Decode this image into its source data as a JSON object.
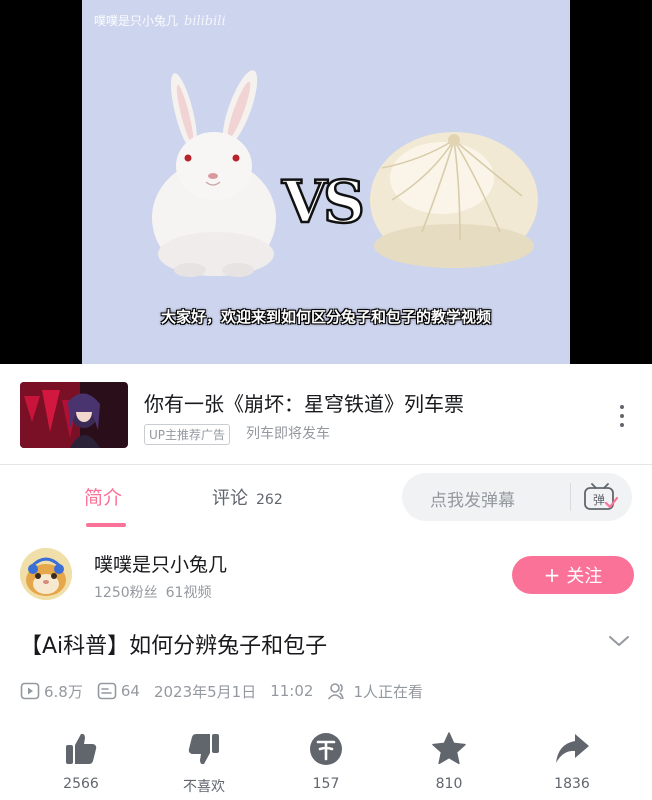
{
  "video": {
    "watermark_text": "噗噗是只小兔几",
    "watermark_logo": "bilibili",
    "subtitle": "大家好，欢迎来到如何区分兔子和包子的教学视频",
    "vs_text": "VS"
  },
  "ad": {
    "title": "你有一张《崩坏：星穹铁道》列车票",
    "badge": "UP主推荐广告",
    "subtitle": "列车即将发车",
    "more_icon": "more-vertical-icon"
  },
  "tabs": {
    "intro_label": "简介",
    "comments_label": "评论",
    "comments_count": "262",
    "danmaku_placeholder": "点我发弹幕",
    "danmaku_icon": "danmaku-tv-icon"
  },
  "uploader": {
    "name": "噗噗是只小兔几",
    "fans": "1250粉丝",
    "videos": "61视频",
    "follow_plus": "+",
    "follow_label": "关注"
  },
  "title": {
    "text": "【Ai科普】如何分辨兔子和包子",
    "expand_icon": "chevron-down-icon"
  },
  "meta": {
    "views": "6.8万",
    "danmaku_count": "64",
    "date": "2023年5月1日",
    "time": "11:02",
    "watching": "1人正在看"
  },
  "actions": {
    "like_count": "2566",
    "dislike_label": "不喜欢",
    "coin_count": "157",
    "favorite_count": "810",
    "share_count": "1836"
  },
  "colors": {
    "brand_pink": "#fb7299",
    "text_primary": "#18191c",
    "text_secondary": "#61666d",
    "text_muted": "#9499a0",
    "video_bg": "#cdd4ee"
  }
}
